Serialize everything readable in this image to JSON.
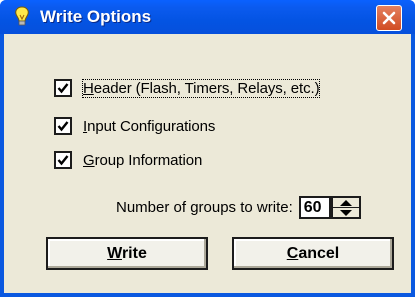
{
  "window": {
    "title": "Write Options",
    "title_icon": "lightbulb-icon",
    "close_icon": "close-icon",
    "title_color": "#0454e3",
    "close_color": "#d14c22"
  },
  "options": [
    {
      "accel": "H",
      "rest": "eader (Flash, Timers, Relays, etc.)",
      "checked": true
    },
    {
      "accel": "I",
      "rest": "nput Configurations",
      "checked": true
    },
    {
      "accel": "G",
      "rest": "roup Information",
      "checked": true
    }
  ],
  "groups": {
    "label": "Number of groups to write:",
    "value": "60"
  },
  "buttons": {
    "write": {
      "accel": "W",
      "rest": "rite"
    },
    "cancel": {
      "accel": "C",
      "rest": "ancel"
    }
  }
}
